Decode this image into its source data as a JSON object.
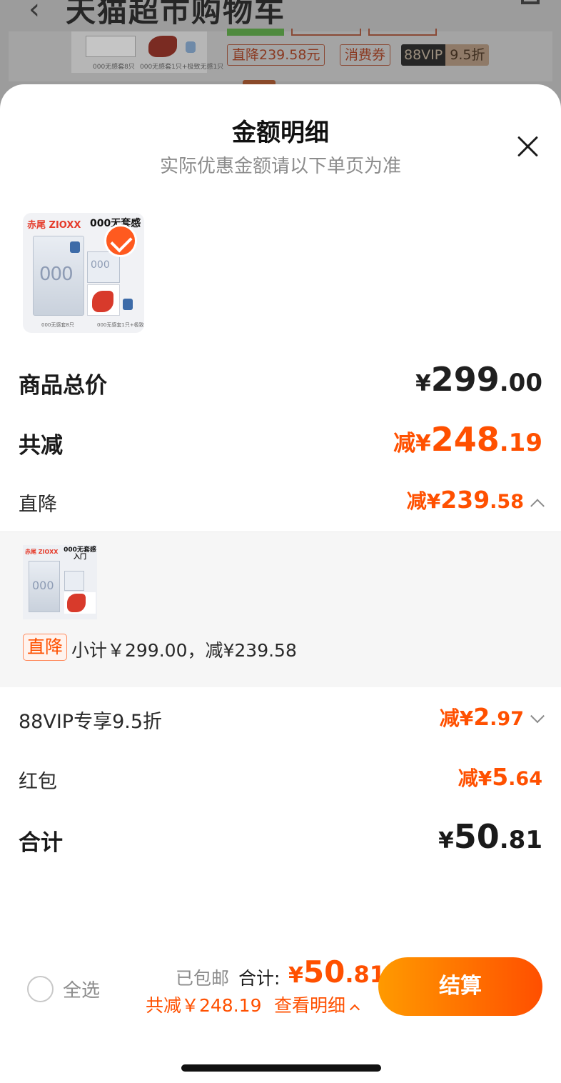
{
  "background": {
    "title": "天猫超市购物车",
    "product_caption_1": "000无感套8只",
    "product_caption_2": "000无感套1只+极致无感1只",
    "tags": [
      "直降239.58元",
      "消费券"
    ],
    "vip_tag": {
      "dark": "88VIP",
      "light": "9.5折"
    }
  },
  "sheet": {
    "title": "金额明细",
    "subtitle": "实际优惠金额请以下单页为准",
    "product_thumb": {
      "brand": "赤尾 ZIOXX",
      "tagline": "000无套感",
      "box_text": "000",
      "caption_left": "000无感套8只",
      "caption_right": "000无感套1只+极致无感1只"
    },
    "rows": {
      "goods_total": {
        "label": "商品总价",
        "yen": "¥",
        "int": "299",
        "dec": ".00"
      },
      "total_discount": {
        "label": "共减",
        "prefix": "减",
        "yen": "¥",
        "int": "248",
        "dec": ".19"
      },
      "direct_discount": {
        "label": "直降",
        "prefix": "减",
        "yen": "¥",
        "int": "239",
        "dec": ".58"
      },
      "vip_discount": {
        "label": "88VIP专享9.5折",
        "prefix": "减",
        "yen": "¥",
        "int": "2",
        "dec": ".97"
      },
      "red_packet": {
        "label": "红包",
        "prefix": "减",
        "yen": "¥",
        "int": "5",
        "dec": ".64"
      },
      "total": {
        "label": "合计",
        "yen": "¥",
        "int": "50",
        "dec": ".81"
      }
    },
    "expanded_panel": {
      "thumb_brand": "赤尾 ZIOXX",
      "thumb_tagline": "000无套感入门",
      "thumb_box_text": "000",
      "tag": "直降",
      "subtotal_text": "小计￥299.00，减¥239.58"
    }
  },
  "bottom_bar": {
    "select_all": "全选",
    "shipping": "已包邮",
    "total_label": "合计:",
    "total_yen": "¥",
    "total_int": "50",
    "total_dec": ".81",
    "discount_text": "共减￥248.19",
    "detail_link": "查看明细",
    "checkout": "结算"
  },
  "colors": {
    "accent": "#ff5000",
    "checkout_gradient_start": "#ff9a00",
    "checkout_gradient_end": "#ff4f00"
  }
}
